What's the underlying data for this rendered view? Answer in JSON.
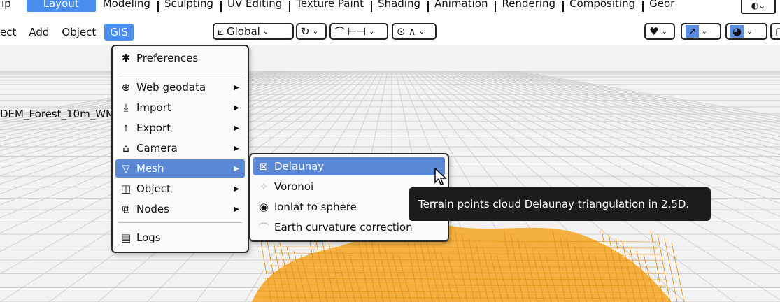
{
  "tabs": [
    {
      "label": "ıp",
      "active": false
    },
    {
      "label": "Layout",
      "active": true
    },
    {
      "label": "Modeling"
    },
    {
      "label": "Sculpting"
    },
    {
      "label": "UV Editing"
    },
    {
      "label": "Texture Paint"
    },
    {
      "label": "Shading"
    },
    {
      "label": "Animation"
    },
    {
      "label": "Rendering"
    },
    {
      "label": "Compositing"
    },
    {
      "label": "Geor"
    }
  ],
  "tabs_menu_icon": "scene-selector-icon",
  "menubar": {
    "select_partial": "ect",
    "add": "Add",
    "object": "Object",
    "gis": "GIS"
  },
  "header_tools": {
    "transform_orientation": "Global"
  },
  "viewport": {
    "object_label": "DEM_Forest_10m_WM"
  },
  "gis_menu": {
    "preferences": "Preferences",
    "web_geodata": "Web geodata",
    "import": "Import",
    "export": "Export",
    "camera": "Camera",
    "mesh": "Mesh",
    "object": "Object",
    "nodes": "Nodes",
    "logs": "Logs"
  },
  "mesh_submenu": {
    "delaunay": "Delaunay",
    "voronoi": "Voronoi",
    "lonlat_to_sphere": "lonlat to sphere",
    "earth_curvature": "Earth curvature correction"
  },
  "tooltip": {
    "text": "Terrain points cloud Delaunay triangulation in 2.5D."
  },
  "colors": {
    "accent": "#4a8ef0",
    "highlight": "#5a88d6",
    "terrain": "#f5a623",
    "tooltip_bg": "#1c1c1c"
  }
}
